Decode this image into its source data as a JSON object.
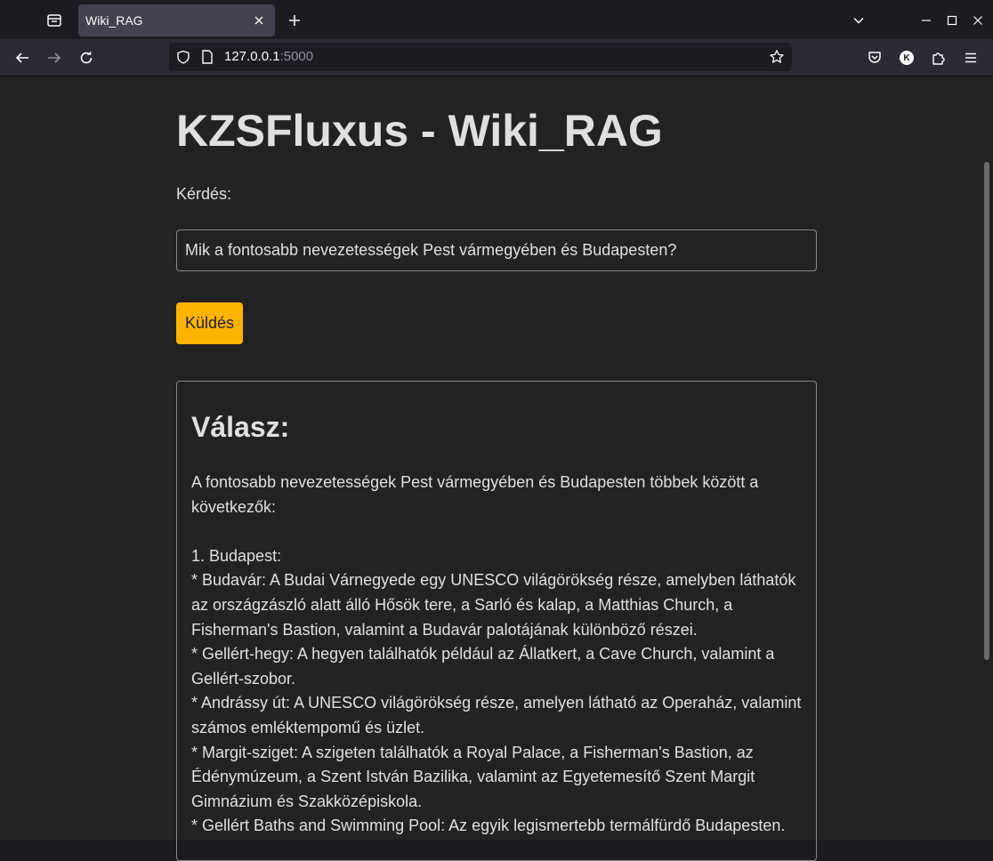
{
  "browser": {
    "tab_title": "Wiki_RAG",
    "url_host": "127.0.0.1",
    "url_port": ":5000",
    "account_initial": "K"
  },
  "page": {
    "title": "KZSFluxus - Wiki_RAG",
    "question_label": "Kérdés:",
    "question_value": "Mik a fontosabb nevezetességek Pest vármegyében és Budapesten?",
    "send_label": "Küldés",
    "answer_heading": "Válasz:",
    "answer_text": "A fontosabb nevezetességek Pest vármegyében és Budapesten többek között a következők:\n\n1. Budapest:\n* Budavár: A Budai Várnegyede egy UNESCO világörökség része, amelyben láthatók az országzászló alatt álló Hősök tere, a Sarló és kalap, a Matthias Church, a Fisherman's Bastion, valamint a Budavár palotájának különböző részei.\n* Gellért-hegy: A hegyen találhatók például az Állatkert, a Cave Church, valamint a Gellért-szobor.\n* Andrássy út: A UNESCO világörökség része, amelyen látható az Operaház, valamint számos emléktempomű és üzlet.\n* Margit-sziget: A szigeten találhatók a Royal Palace, a Fisherman's Bastion, az Édénymúzeum, a Szent István Bazilika, valamint az Egyetemesítő Szent Margit Gimnázium és Szakközépiskola.\n* Gellért Baths and Swimming Pool: Az egyik legismertebb termálfürdő Budapesten."
  },
  "colors": {
    "accent": "#ffb400",
    "page_bg": "#222222",
    "chrome_bg": "#1c1b22",
    "toolbar_bg": "#2b2a33"
  }
}
